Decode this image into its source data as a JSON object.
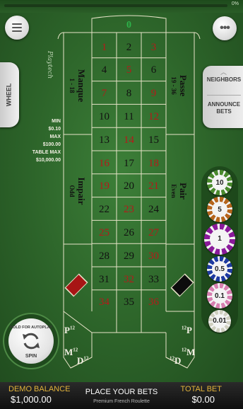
{
  "top": {
    "progress_percent": 0,
    "progress_text": "0%"
  },
  "menu": {
    "icon": "hamburger-menu-icon"
  },
  "more": {
    "icon": "more-dots-icon",
    "label": "•••"
  },
  "wheel_tab": {
    "label": "WHEEL"
  },
  "right_panel": {
    "neighbors_label": "NEIGHBORS",
    "announce_label_1": "ANNOUNCE",
    "announce_label_2": "BETS"
  },
  "limits": {
    "min_label": "MIN",
    "min_value": "$0.10",
    "max_label": "MAX",
    "max_value": "$100.00",
    "table_max_label": "TABLE MAX",
    "table_max_value": "$10,000.00"
  },
  "logo": "Playtech",
  "table": {
    "zero": "0",
    "numbers": [
      {
        "n": "1",
        "c": "red"
      },
      {
        "n": "2",
        "c": "black"
      },
      {
        "n": "3",
        "c": "red"
      },
      {
        "n": "4",
        "c": "black"
      },
      {
        "n": "5",
        "c": "red"
      },
      {
        "n": "6",
        "c": "black"
      },
      {
        "n": "7",
        "c": "red"
      },
      {
        "n": "8",
        "c": "black"
      },
      {
        "n": "9",
        "c": "red"
      },
      {
        "n": "10",
        "c": "black"
      },
      {
        "n": "11",
        "c": "black"
      },
      {
        "n": "12",
        "c": "red"
      },
      {
        "n": "13",
        "c": "black"
      },
      {
        "n": "14",
        "c": "red"
      },
      {
        "n": "15",
        "c": "black"
      },
      {
        "n": "16",
        "c": "red"
      },
      {
        "n": "17",
        "c": "black"
      },
      {
        "n": "18",
        "c": "red"
      },
      {
        "n": "19",
        "c": "red"
      },
      {
        "n": "20",
        "c": "black"
      },
      {
        "n": "21",
        "c": "red"
      },
      {
        "n": "22",
        "c": "black"
      },
      {
        "n": "23",
        "c": "red"
      },
      {
        "n": "24",
        "c": "black"
      },
      {
        "n": "25",
        "c": "red"
      },
      {
        "n": "26",
        "c": "black"
      },
      {
        "n": "27",
        "c": "red"
      },
      {
        "n": "28",
        "c": "black"
      },
      {
        "n": "29",
        "c": "black"
      },
      {
        "n": "30",
        "c": "red"
      },
      {
        "n": "31",
        "c": "black"
      },
      {
        "n": "32",
        "c": "red"
      },
      {
        "n": "33",
        "c": "black"
      },
      {
        "n": "34",
        "c": "red"
      },
      {
        "n": "35",
        "c": "black"
      },
      {
        "n": "36",
        "c": "red"
      }
    ],
    "manque": "Manque",
    "manque_range": "1 - 18",
    "passe": "Passe",
    "passe_range": "19 - 36",
    "impair": "Impair",
    "impair_sub": "Odd",
    "pair": "Pair",
    "pair_sub": "Even",
    "column_bets": [
      {
        "letter": "P",
        "sub": "12"
      },
      {
        "letter": "M",
        "sub": "12"
      },
      {
        "letter": "D",
        "sub": "12"
      }
    ]
  },
  "chips": [
    {
      "value": "10",
      "color": "#4a8a2e"
    },
    {
      "value": "5",
      "color": "#b5651d"
    },
    {
      "value": "1",
      "color": "#8a1a9a"
    },
    {
      "value": "0.5",
      "color": "#1e3aa0"
    },
    {
      "value": "0.1",
      "color": "#d77fb0"
    },
    {
      "value": "0.01",
      "color": "#cfcfbf"
    }
  ],
  "spin": {
    "top_text": "HOLD FOR AUTOPLAY",
    "label": "SPIN",
    "icon": "refresh-arrows-icon"
  },
  "bottom": {
    "balance_label": "DEMO BALANCE",
    "balance_value": "$1,000.00",
    "status": "PLACE YOUR BETS",
    "game_name": "Premium French Roulette",
    "total_bet_label": "TOTAL BET",
    "total_bet_value": "$0.00"
  },
  "colors": {
    "felt": "#2f6a2d",
    "accent_gold": "#e2b33a",
    "red": "#b51a1a",
    "zero_green": "#2db34a"
  }
}
